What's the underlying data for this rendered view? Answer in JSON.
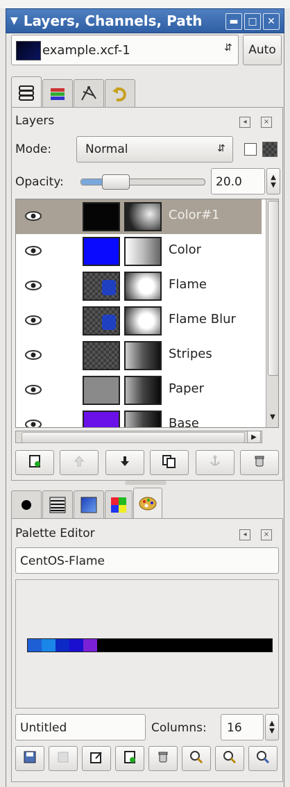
{
  "window": {
    "title": "Layers, Channels, Path",
    "menu_icon": "chevron-down-icon",
    "buttons": [
      "minimize-icon",
      "maximize-icon",
      "close-icon"
    ]
  },
  "image_selector": {
    "value": "example.xcf-1",
    "auto_label": "Auto"
  },
  "top_tabs": [
    {
      "icon": "layers-icon",
      "active": true
    },
    {
      "icon": "channels-icon",
      "active": false
    },
    {
      "icon": "paths-icon",
      "active": false
    },
    {
      "icon": "undo-history-icon",
      "active": false
    }
  ],
  "layers_panel": {
    "title": "Layers",
    "mode_label": "Mode:",
    "mode_value": "Normal",
    "opacity_label": "Opacity:",
    "opacity_value": "20.0",
    "opacity_fraction": 0.2,
    "layers": [
      {
        "name": "Color#1",
        "selected": true,
        "thumb": "black",
        "mask": "flame-mask"
      },
      {
        "name": "Color",
        "selected": false,
        "thumb": "blue",
        "mask": "white-grad"
      },
      {
        "name": "Flame",
        "selected": false,
        "thumb": "checker-blue",
        "mask": "white-radial"
      },
      {
        "name": "Flame Blur",
        "selected": false,
        "thumb": "checker-blue",
        "mask": "white-radial"
      },
      {
        "name": "Stripes",
        "selected": false,
        "thumb": "checker",
        "mask": "grey-grad"
      },
      {
        "name": "Paper",
        "selected": false,
        "thumb": "grey",
        "mask": "dark-grad"
      },
      {
        "name": "Base",
        "selected": false,
        "thumb": "purple",
        "mask": "dark-grad"
      }
    ],
    "buttons": [
      {
        "icon": "new-layer-icon",
        "enabled": true
      },
      {
        "icon": "raise-layer-icon",
        "enabled": false
      },
      {
        "icon": "lower-layer-icon",
        "enabled": true
      },
      {
        "icon": "duplicate-layer-icon",
        "enabled": true
      },
      {
        "icon": "anchor-layer-icon",
        "enabled": false
      },
      {
        "icon": "delete-layer-icon",
        "enabled": true
      }
    ]
  },
  "bottom_tabs": [
    {
      "icon": "brush-icon"
    },
    {
      "icon": "pattern-icon"
    },
    {
      "icon": "gradient-icon"
    },
    {
      "icon": "palettes-icon"
    },
    {
      "icon": "palette-editor-icon",
      "active": true
    }
  ],
  "palette_editor": {
    "title": "Palette Editor",
    "palette_name": "CentOS-Flame",
    "swatches": [
      "#1f5fd6",
      "#1a86e8",
      "#0d29c6",
      "#1a0fcf",
      "#7a20d6",
      "#000000"
    ],
    "entry_name": "Untitled",
    "columns_label": "Columns:",
    "columns_value": "16",
    "buttons": [
      {
        "icon": "save-icon",
        "enabled": true
      },
      {
        "icon": "revert-icon",
        "enabled": false
      },
      {
        "icon": "edit-color-icon",
        "enabled": true
      },
      {
        "icon": "new-color-icon",
        "enabled": true
      },
      {
        "icon": "delete-color-icon",
        "enabled": true
      },
      {
        "icon": "zoom-out-icon",
        "enabled": true
      },
      {
        "icon": "zoom-in-icon",
        "enabled": true
      },
      {
        "icon": "zoom-all-icon",
        "enabled": true
      }
    ]
  },
  "colors": {
    "title_bar": "#2f5fa4",
    "selected_row": "#a9a195",
    "background": "#e9e8e6"
  }
}
